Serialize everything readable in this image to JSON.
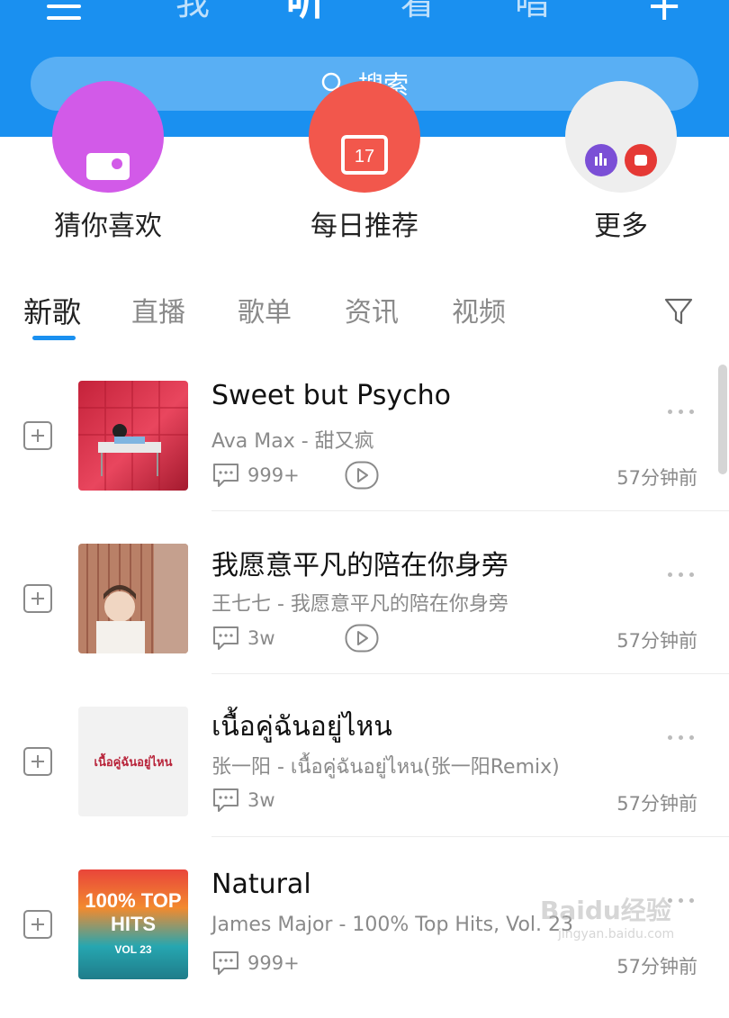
{
  "top_nav": {
    "tabs": [
      "我",
      "听",
      "看",
      "唱"
    ],
    "active_tab": "听"
  },
  "search": {
    "placeholder": "搜索"
  },
  "quick_access": [
    {
      "label": "猜你喜欢",
      "color": "#d25ae8",
      "icon": "radio-icon"
    },
    {
      "label": "每日推荐",
      "color": "#f2574c",
      "icon": "calendar-icon",
      "badge": "17"
    },
    {
      "label": "更多",
      "color": "#eeeeee",
      "icon": "more-apps-icon"
    }
  ],
  "content_tabs": [
    "新歌",
    "直播",
    "歌单",
    "资讯",
    "视频"
  ],
  "active_content_tab": "新歌",
  "songs": [
    {
      "title": "Sweet but Psycho",
      "subtitle": "Ava Max - 甜又疯",
      "comments": "999+",
      "time": "57分钟前",
      "has_play": true
    },
    {
      "title": "我愿意平凡的陪在你身旁",
      "subtitle": "王七七 - 我愿意平凡的陪在你身旁",
      "comments": "3w",
      "time": "57分钟前",
      "has_play": true
    },
    {
      "title": "เนื้อคู่ฉันอยู่ไหน",
      "subtitle": "张一阳 - เนื้อคู่ฉันอยู่ไหน(张一阳Remix)",
      "comments": "3w",
      "time": "57分钟前",
      "has_play": false,
      "cover_text": "เนื้อคู่ฉันอยู่ไหน"
    },
    {
      "title": "Natural",
      "subtitle": "James Major - 100% Top Hits, Vol. 23",
      "comments": "999+",
      "time": "57分钟前",
      "has_play": false,
      "cover_text": "100% TOP HITS",
      "cover_sub": "VOL 23"
    }
  ],
  "watermark": {
    "brand": "Baidu经验",
    "url": "jingyan.baidu.com"
  }
}
